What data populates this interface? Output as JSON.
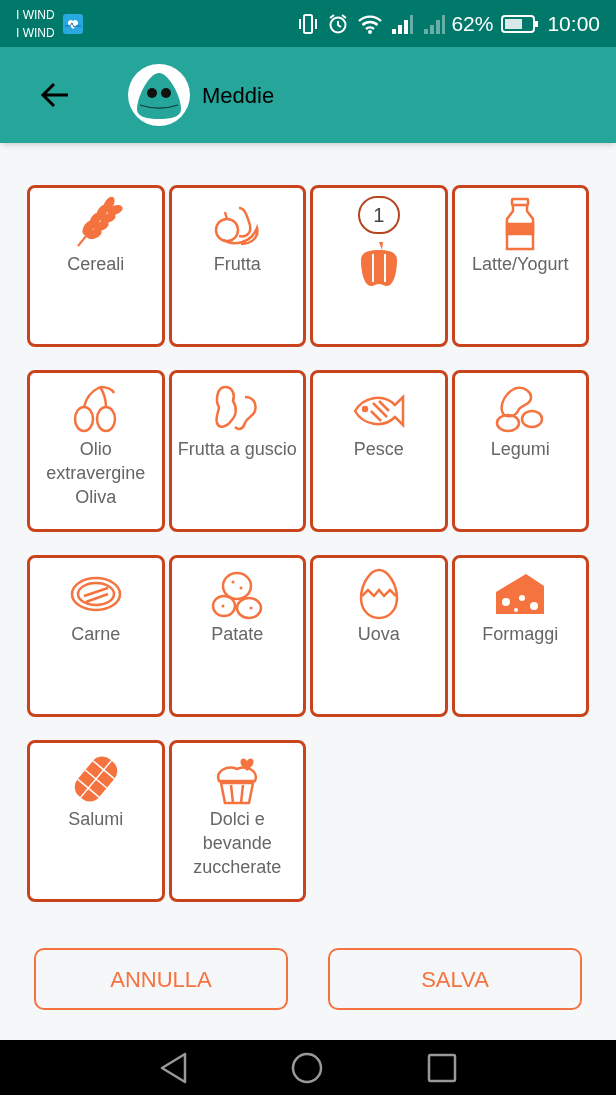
{
  "status_bar": {
    "carriers": [
      "I WIND",
      "I WIND"
    ],
    "battery": "62%",
    "time": "10:00"
  },
  "header": {
    "title": "Meddie"
  },
  "categories": [
    {
      "label": "Cereali"
    },
    {
      "label": "Frutta"
    },
    {
      "count": "1"
    },
    {
      "label": "Latte/Yogurt"
    },
    {
      "label": "Olio extravergine Oliva"
    },
    {
      "label": "Frutta a guscio"
    },
    {
      "label": "Pesce"
    },
    {
      "label": "Legumi"
    },
    {
      "label": "Carne"
    },
    {
      "label": "Patate"
    },
    {
      "label": "Uova"
    },
    {
      "label": "Formaggi"
    },
    {
      "label": "Salumi"
    },
    {
      "label": "Dolci e bevande zuccherate"
    }
  ],
  "buttons": [
    "ANNULLA",
    "SALVA"
  ]
}
